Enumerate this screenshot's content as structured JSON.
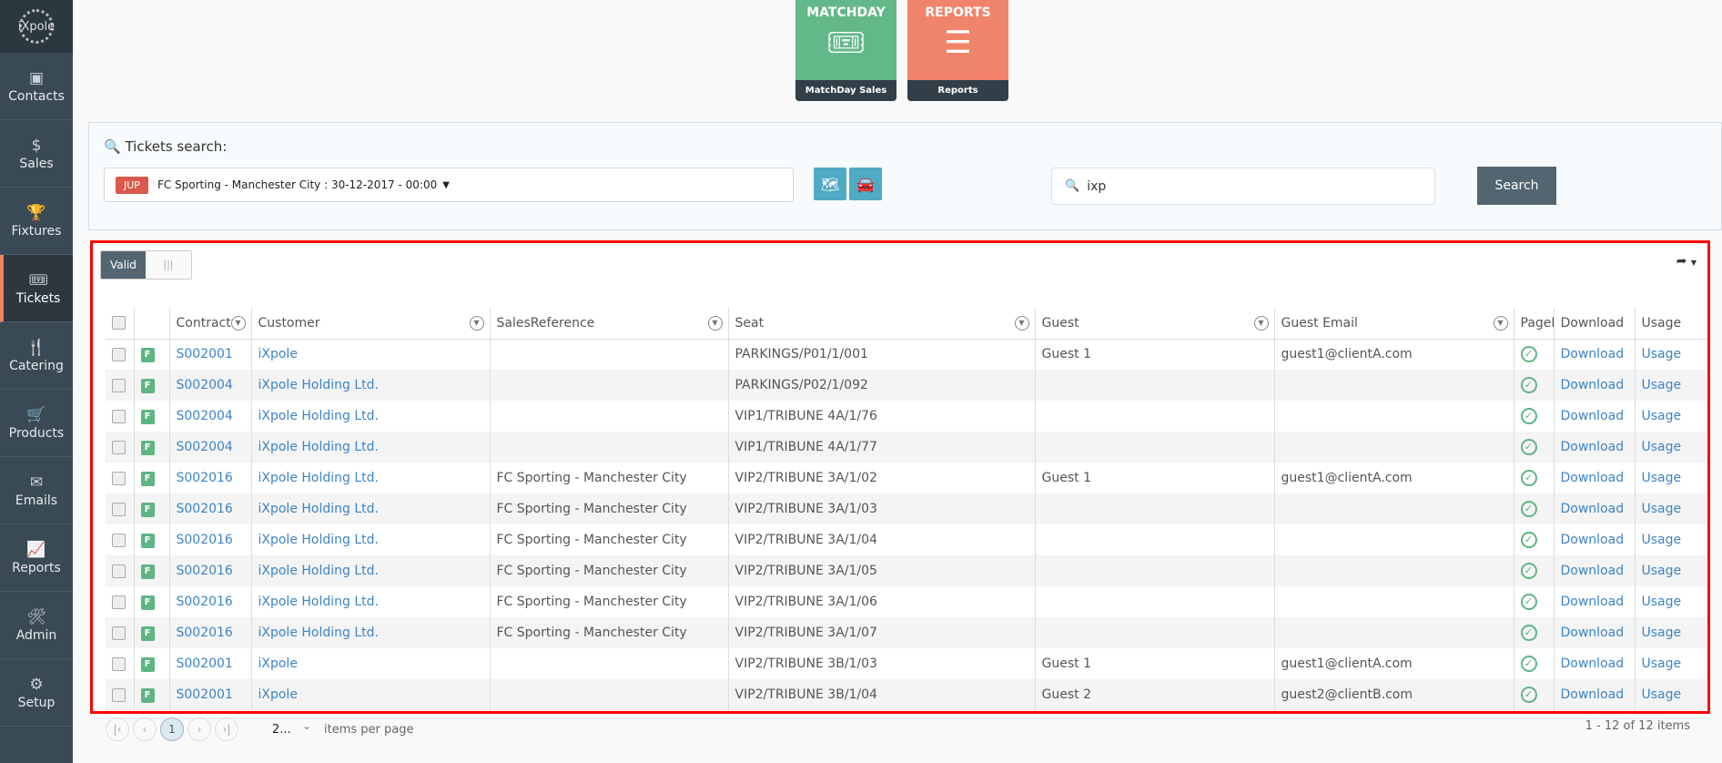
{
  "brand": "iXpole",
  "sidebar": {
    "items": [
      {
        "label": "Contacts",
        "icon": "contact-card-icon",
        "glyph": "▣"
      },
      {
        "label": "Sales",
        "icon": "dollar-icon",
        "glyph": "$"
      },
      {
        "label": "Fixtures",
        "icon": "trophy-icon",
        "glyph": "🏆"
      },
      {
        "label": "Tickets",
        "icon": "ticket-icon",
        "glyph": "🎟"
      },
      {
        "label": "Catering",
        "icon": "cutlery-icon",
        "glyph": "🍴"
      },
      {
        "label": "Products",
        "icon": "cart-icon",
        "glyph": "🛒"
      },
      {
        "label": "Emails",
        "icon": "envelope-icon",
        "glyph": "✉"
      },
      {
        "label": "Reports",
        "icon": "chart-icon",
        "glyph": "📈"
      },
      {
        "label": "Admin",
        "icon": "tools-icon",
        "glyph": "🛠"
      },
      {
        "label": "Setup",
        "icon": "gears-icon",
        "glyph": "⚙"
      }
    ],
    "active": "Tickets"
  },
  "tiles": [
    {
      "title": "MATCHDAY",
      "footer": "MatchDay Sales",
      "color": "#63b889",
      "glyph": "🎟"
    },
    {
      "title": "REPORTS",
      "footer": "Reports",
      "color": "#f0846a",
      "glyph": "☰"
    }
  ],
  "search": {
    "title": "Tickets search:",
    "event_badge": "JUP",
    "event": "FC Sporting - Manchester City : 30-12-2017 - 00:00",
    "query": "ixp",
    "button": "Search"
  },
  "grid": {
    "toggle_on": "Valid",
    "toggle_off": "|||",
    "columns": [
      "Contract",
      "Customer",
      "SalesReference",
      "Seat",
      "Guest",
      "Guest Email",
      "PageF",
      "Download",
      "Usage"
    ],
    "rows": [
      {
        "type": "F",
        "contract": "S002001",
        "customer": "iXpole",
        "salesref": "",
        "seat": "PARKINGS/P01/1/001",
        "guest": "Guest 1",
        "email": "guest1@clientA.com",
        "download": "Download",
        "usage": "Usage"
      },
      {
        "type": "F",
        "contract": "S002004",
        "customer": "iXpole Holding Ltd.",
        "salesref": "",
        "seat": "PARKINGS/P02/1/092",
        "guest": "",
        "email": "",
        "download": "Download",
        "usage": "Usage"
      },
      {
        "type": "F",
        "contract": "S002004",
        "customer": "iXpole Holding Ltd.",
        "salesref": "",
        "seat": "VIP1/TRIBUNE 4A/1/76",
        "guest": "",
        "email": "",
        "download": "Download",
        "usage": "Usage"
      },
      {
        "type": "F",
        "contract": "S002004",
        "customer": "iXpole Holding Ltd.",
        "salesref": "",
        "seat": "VIP1/TRIBUNE 4A/1/77",
        "guest": "",
        "email": "",
        "download": "Download",
        "usage": "Usage"
      },
      {
        "type": "F",
        "contract": "S002016",
        "customer": "iXpole Holding Ltd.",
        "salesref": "FC Sporting - Manchester City",
        "seat": "VIP2/TRIBUNE 3A/1/02",
        "guest": "Guest 1",
        "email": "guest1@clientA.com",
        "download": "Download",
        "usage": "Usage"
      },
      {
        "type": "F",
        "contract": "S002016",
        "customer": "iXpole Holding Ltd.",
        "salesref": "FC Sporting - Manchester City",
        "seat": "VIP2/TRIBUNE 3A/1/03",
        "guest": "",
        "email": "",
        "download": "Download",
        "usage": "Usage"
      },
      {
        "type": "F",
        "contract": "S002016",
        "customer": "iXpole Holding Ltd.",
        "salesref": "FC Sporting - Manchester City",
        "seat": "VIP2/TRIBUNE 3A/1/04",
        "guest": "",
        "email": "",
        "download": "Download",
        "usage": "Usage"
      },
      {
        "type": "F",
        "contract": "S002016",
        "customer": "iXpole Holding Ltd.",
        "salesref": "FC Sporting - Manchester City",
        "seat": "VIP2/TRIBUNE 3A/1/05",
        "guest": "",
        "email": "",
        "download": "Download",
        "usage": "Usage"
      },
      {
        "type": "F",
        "contract": "S002016",
        "customer": "iXpole Holding Ltd.",
        "salesref": "FC Sporting - Manchester City",
        "seat": "VIP2/TRIBUNE 3A/1/06",
        "guest": "",
        "email": "",
        "download": "Download",
        "usage": "Usage"
      },
      {
        "type": "F",
        "contract": "S002016",
        "customer": "iXpole Holding Ltd.",
        "salesref": "FC Sporting - Manchester City",
        "seat": "VIP2/TRIBUNE 3A/1/07",
        "guest": "",
        "email": "",
        "download": "Download",
        "usage": "Usage"
      },
      {
        "type": "F",
        "contract": "S002001",
        "customer": "iXpole",
        "salesref": "",
        "seat": "VIP2/TRIBUNE 3B/1/03",
        "guest": "Guest 1",
        "email": "guest1@clientA.com",
        "download": "Download",
        "usage": "Usage"
      },
      {
        "type": "F",
        "contract": "S002001",
        "customer": "iXpole",
        "salesref": "",
        "seat": "VIP2/TRIBUNE 3B/1/04",
        "guest": "Guest 2",
        "email": "guest2@clientB.com",
        "download": "Download",
        "usage": "Usage"
      }
    ]
  },
  "pager": {
    "current": "1",
    "page_size": "2...",
    "page_size_label": "items per page",
    "info": "1 - 12 of 12 items"
  }
}
